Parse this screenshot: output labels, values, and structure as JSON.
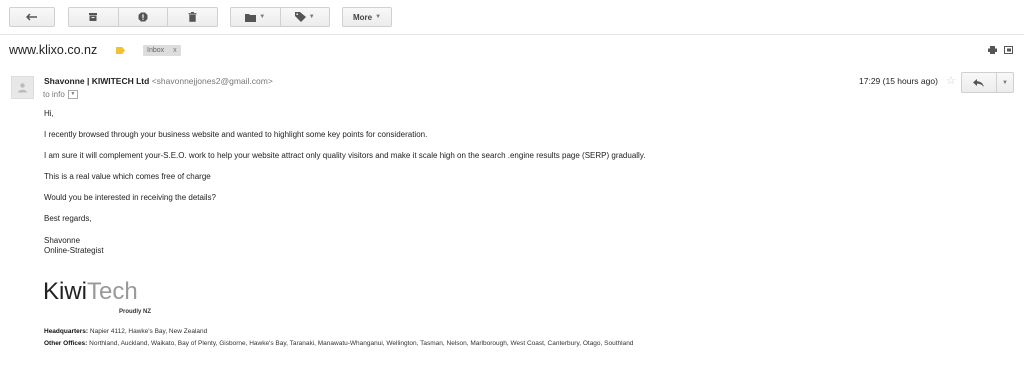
{
  "toolbar": {
    "more_label": "More"
  },
  "subject": {
    "title": "www.klixo.co.nz",
    "label_chip": "Inbox",
    "label_chip_close": "x"
  },
  "message": {
    "sender_name": "Shavonne | KIWITECH Ltd",
    "sender_email": "<shavonnejjones2@gmail.com>",
    "to_text": "to info",
    "time": "17:29 (15 hours ago)",
    "body": {
      "greeting": "Hi,",
      "p1": "I recently browsed through your business website and wanted to highlight some key points for consideration.",
      "p2": "I am sure it will complement your-S.E.O. work to help your website attract only quality visitors and make it scale high on the search .engine results page (SERP) gradually.",
      "p3": "This is a real value which comes free of charge",
      "p4": "Would you be interested in receiving the details?",
      "closing": "Best regards,",
      "sig_name": "Shavonne",
      "sig_title": "Online-Strategist"
    },
    "signature": {
      "logo_part1": "Kiwi",
      "logo_part2": "Tech",
      "tagline": "Proudly NZ",
      "hq_label": "Headquarters:",
      "hq_value": "Napier 4112, Hawke's Bay, New Zealand",
      "offices_label": "Other Offices:",
      "offices_value": "Northland, Auckland, Waikato, Bay of Plenty, Gisborne, Hawke's Bay, Taranaki, Manawatu-Whanganui, Wellington, Tasman, Nelson, Marlborough, West Coast, Canterbury, Otago, Southland"
    }
  },
  "colors": {
    "label_tag": "#f1c232",
    "logo_light": "#999999"
  }
}
